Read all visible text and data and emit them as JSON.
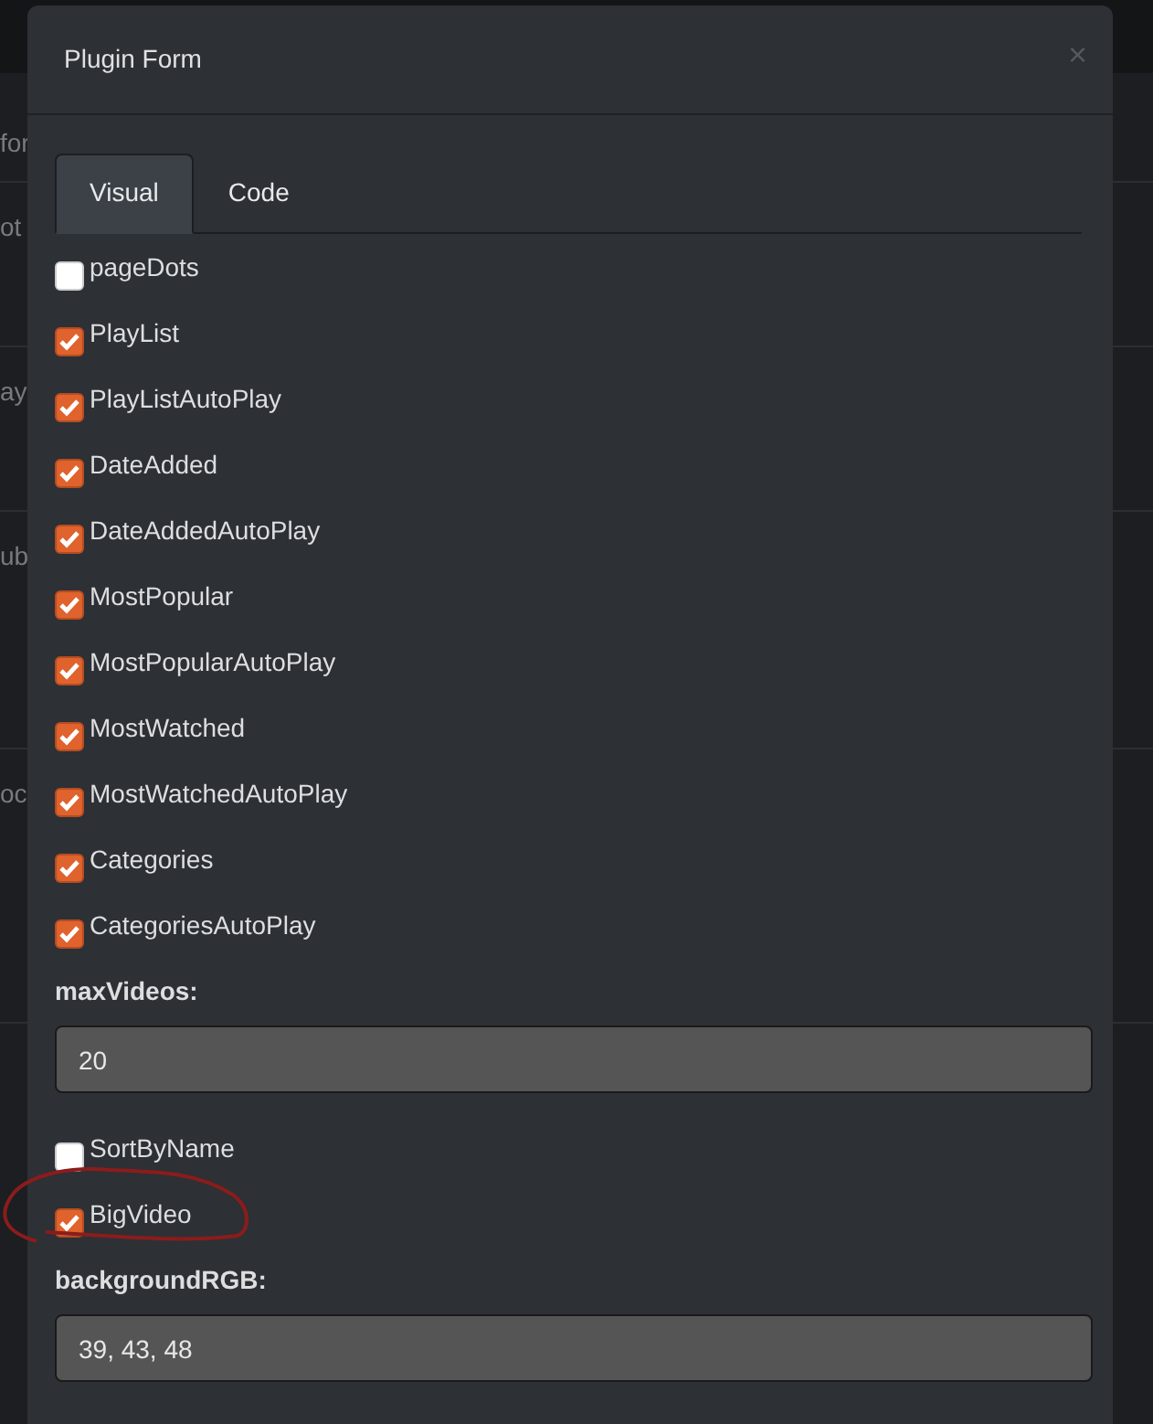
{
  "backdrop": {
    "rows": [
      "for",
      "ot",
      "ay",
      "ub",
      "oc"
    ]
  },
  "modal": {
    "title": "Plugin Form",
    "close": "×",
    "tabs": [
      {
        "label": "Visual",
        "selected": true
      },
      {
        "label": "Code",
        "selected": false
      }
    ],
    "fields": [
      {
        "kind": "checkbox",
        "label": "pageDots",
        "checked": false
      },
      {
        "kind": "checkbox",
        "label": "PlayList",
        "checked": true
      },
      {
        "kind": "checkbox",
        "label": "PlayListAutoPlay",
        "checked": true
      },
      {
        "kind": "checkbox",
        "label": "DateAdded",
        "checked": true
      },
      {
        "kind": "checkbox",
        "label": "DateAddedAutoPlay",
        "checked": true
      },
      {
        "kind": "checkbox",
        "label": "MostPopular",
        "checked": true
      },
      {
        "kind": "checkbox",
        "label": "MostPopularAutoPlay",
        "checked": true
      },
      {
        "kind": "checkbox",
        "label": "MostWatched",
        "checked": true
      },
      {
        "kind": "checkbox",
        "label": "MostWatchedAutoPlay",
        "checked": true
      },
      {
        "kind": "checkbox",
        "label": "Categories",
        "checked": true
      },
      {
        "kind": "checkbox",
        "label": "CategoriesAutoPlay",
        "checked": true
      },
      {
        "kind": "text",
        "label": "maxVideos:",
        "value": "20"
      },
      {
        "kind": "checkbox",
        "label": "SortByName",
        "checked": false
      },
      {
        "kind": "checkbox",
        "label": "BigVideo",
        "checked": true
      },
      {
        "kind": "text",
        "label": "backgroundRGB:",
        "value": "39, 43, 48"
      }
    ]
  }
}
